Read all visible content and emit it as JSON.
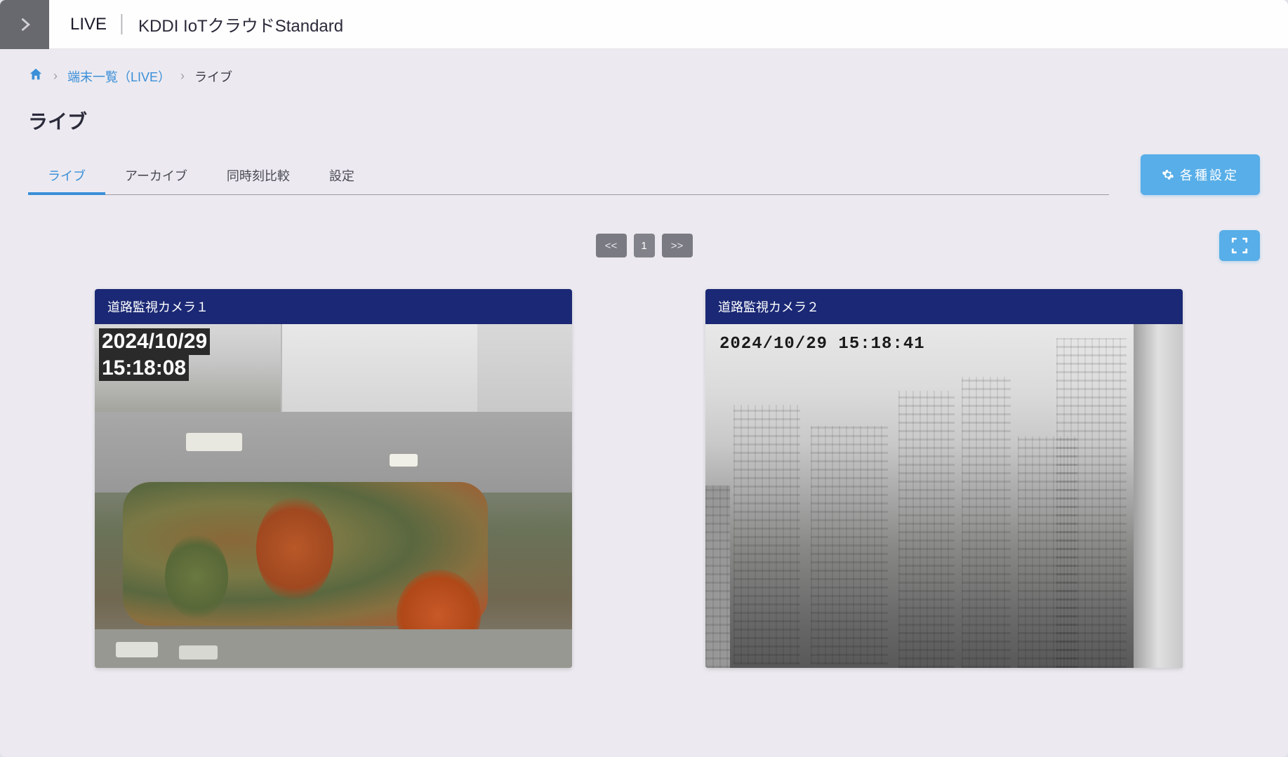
{
  "header": {
    "title_main": "LIVE",
    "title_sub": "KDDI IoTクラウドStandard"
  },
  "breadcrumb": {
    "link1": "端末一覧（LIVE）",
    "current": "ライブ"
  },
  "page_title": "ライブ",
  "tabs": [
    {
      "label": "ライブ",
      "active": true
    },
    {
      "label": "アーカイブ",
      "active": false
    },
    {
      "label": "同時刻比較",
      "active": false
    },
    {
      "label": "設定",
      "active": false
    }
  ],
  "buttons": {
    "settings": "各種設定",
    "pager_prev": "<<",
    "pager_page": "1",
    "pager_next": ">>"
  },
  "cameras": [
    {
      "title": "道路監視カメラ１",
      "osd_date": "2024/10/29",
      "osd_time": "15:18:08"
    },
    {
      "title": "道路監視カメラ２",
      "osd_combined": "2024/10/29  15:18:41"
    }
  ]
}
